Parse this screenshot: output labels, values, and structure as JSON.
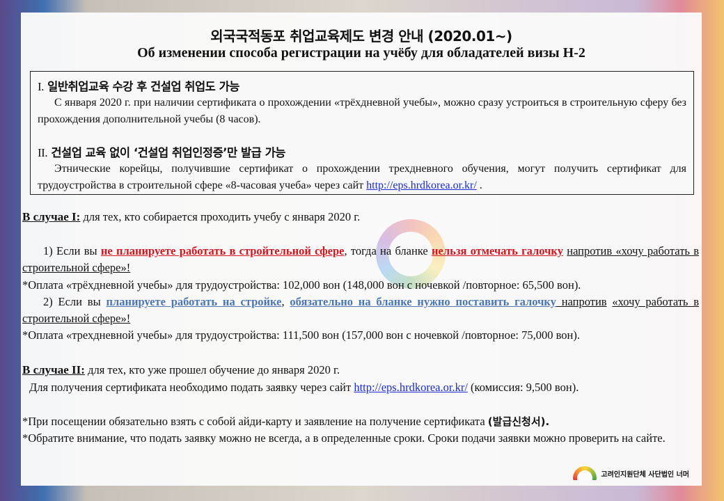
{
  "title": {
    "ko": "외국국적동포 취업교육제도 변경 안내 (2020.01~)",
    "ru": "Об изменении способа регистрации на учёбу для обладателей визы H-2"
  },
  "box": {
    "sec1": {
      "num": "I.",
      "heading": "일반취업교육 수강 후 건설업 취업도 가능",
      "text": "С января 2020 г. при наличии сертификата о прохождении «трёхдневной учебы», можно сразу устроиться в строительную сферу без прохождения дополнительной учебы (8 часов)."
    },
    "sec2": {
      "num": "II.",
      "heading": "건설업 교육 없이 ‘건설업 취업인정증’만 발급 가능",
      "text": "Этнические корейцы, получившие сертификат о прохождении трехдневного обучения, могут получить сертификат для трудоустройства в строительной сфере «8-часовая учеба» через сайт ",
      "link": "http://eps.hrdkorea.or.kr/",
      "end": " ."
    }
  },
  "case1": {
    "label": "В случае I:",
    "text": " для тех, кто собирается проходить учебу с января 2020 г.",
    "p1": {
      "a": "1) Если вы ",
      "red1": "не планируете работать в стройтельной сфере",
      "b": ", тогда на бланке ",
      "red2": "нельзя отмечать галочку",
      "c": "напротив «хочу работать в строительной сфере»!"
    },
    "fee1": "*Оплата «трёхдневной учебы» для трудоустройства: 102,000 вон (148,000 вон с ночевкой /повторное: 65,500 вон).",
    "p2": {
      "a": "2) Если вы ",
      "blue1": "планируете работать на стройке",
      "b": ", ",
      "blue2": "обязательно на бланке нужно поставить галочку",
      "c": " напротив",
      "d": "«хочу работать в строительной сфере»!"
    },
    "fee2": "*Оплата «трехдневной учебы» для трудоустройства: 111,500 вон (157,000 вон с ночевкой /повторное: 75,000 вон)."
  },
  "case2": {
    "label": "В случае II:",
    "text": " для тех, кто уже прошел обучение до января 2020 г.",
    "line": "Для получения сертификата необходимо подать заявку через сайт ",
    "link": "http://eps.hrdkorea.or.kr/",
    "line_end": " (комиссия: 9,500 вон)."
  },
  "notes": {
    "n1": "*При посещении обязательно взять с собой айди-карту и заявление на получение сертификата ",
    "n1_ko": "(발급신청서).",
    "n2": "*Обратите внимание, что подать заявку можно не всегда, а в определенные сроки. Сроки подачи заявки можно проверить на сайте."
  },
  "footer": {
    "logo_text": "너머",
    "org": "고려인지원단체 사단법인 너머"
  }
}
